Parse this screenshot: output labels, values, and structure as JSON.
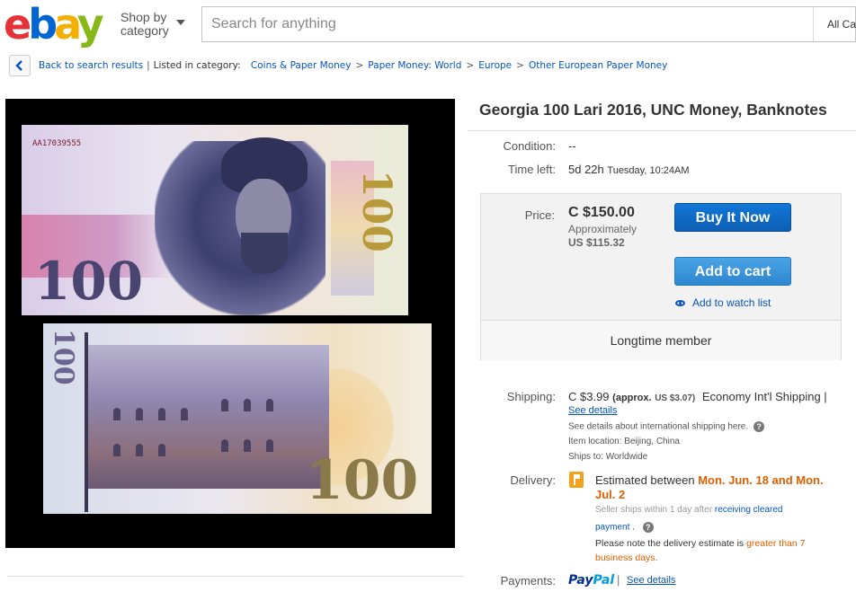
{
  "header": {
    "logo_letters": [
      "e",
      "b",
      "a",
      "y"
    ],
    "logo_colors": [
      "#e53238",
      "#0064d2",
      "#f5af02",
      "#86b817"
    ],
    "shop_by_line1": "Shop by",
    "shop_by_line2": "category",
    "search_placeholder": "Search for anything",
    "category_select": "All Ca"
  },
  "breadcrumb": {
    "back_label": "Back to search results",
    "listed_in": "Listed in category:",
    "categories": [
      "Coins & Paper Money",
      "Paper Money: World",
      "Europe",
      "Other European Paper Money"
    ]
  },
  "image": {
    "serial": "AA17039555",
    "denomination": "100"
  },
  "item": {
    "title": "Georgia 100 Lari 2016, UNC Money, Banknotes",
    "condition_label": "Condition:",
    "condition_value": "--",
    "time_left_label": "Time left:",
    "time_left_value": "5d 22h",
    "time_left_date": "Tuesday, 10:24AM",
    "price_label": "Price:",
    "price_value": "C $150.00",
    "approx_label": "Approximately",
    "approx_value": "US $115.32",
    "buy_now": "Buy It Now",
    "add_to_cart": "Add to cart",
    "watch_list": "Add to watch list",
    "seller_note": "Longtime member"
  },
  "shipping": {
    "label": "Shipping:",
    "cost": "C $3.99",
    "approx": "(approx.",
    "approx_value": "US $3.07)",
    "method": "Economy Int'l Shipping |",
    "see_details": "See details",
    "intl_note": "See details about international shipping here.",
    "location": "Item location:  Beijing, China",
    "ships_to": "Ships to:  Worldwide"
  },
  "delivery": {
    "label": "Delivery:",
    "estimated_prefix": "Estimated between",
    "estimated_dates_1": "Mon. Jun. 18 and Mon.",
    "estimated_dates_2": "Jul. 2",
    "seller_ships": "Seller ships within 1 day after",
    "receiving_cleared": "receiving cleared",
    "payment": "payment",
    "payment_dot": ".",
    "note_prefix": "Please note the delivery estimate is",
    "note_highlight_1": "greater than 7",
    "note_highlight_2": "business days."
  },
  "payments": {
    "label": "Payments:",
    "paypal_pay": "Pay",
    "paypal_pal": "Pal",
    "see_details": "See details"
  }
}
